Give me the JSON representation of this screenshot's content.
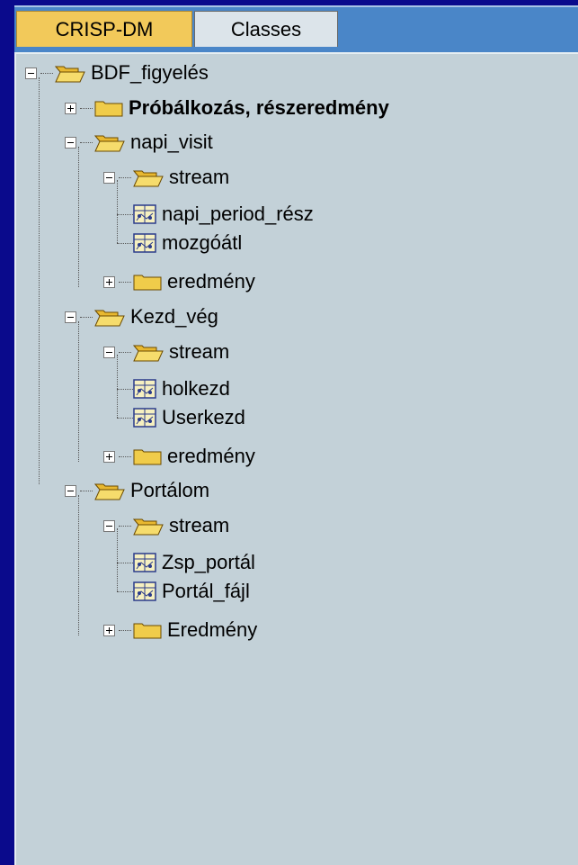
{
  "tabs": [
    {
      "label": "CRISP-DM",
      "active": true
    },
    {
      "label": "Classes",
      "active": false
    }
  ],
  "tree": {
    "root": "BDF_figyelés",
    "items": [
      {
        "label": "Próbálkozás, részeredmény",
        "type": "folder",
        "expanded": false
      },
      {
        "label": "napi_visit",
        "type": "folder",
        "expanded": true
      },
      {
        "label": "stream",
        "type": "folder",
        "expanded": true
      },
      {
        "label": "napi_period_rész",
        "type": "stream"
      },
      {
        "label": "mozgóátl",
        "type": "stream"
      },
      {
        "label": "eredmény",
        "type": "folder",
        "expanded": false
      },
      {
        "label": "Kezd_vég",
        "type": "folder",
        "expanded": true
      },
      {
        "label": "stream",
        "type": "folder",
        "expanded": true
      },
      {
        "label": "holkezd",
        "type": "stream"
      },
      {
        "label": "Userkezd",
        "type": "stream"
      },
      {
        "label": "eredmény",
        "type": "folder",
        "expanded": false
      },
      {
        "label": "Portálom",
        "type": "folder",
        "expanded": true
      },
      {
        "label": "stream",
        "type": "folder",
        "expanded": true
      },
      {
        "label": "Zsp_portál",
        "type": "stream"
      },
      {
        "label": "Portál_fájl",
        "type": "stream"
      },
      {
        "label": "Eredmény",
        "type": "folder",
        "expanded": false
      }
    ]
  },
  "colors": {
    "background": "#0a0a8c",
    "tabbar": "#4a86c8",
    "active_tab": "#f2c95a",
    "panel": "#c3d1d8",
    "folder": "#f0cc4a"
  },
  "icons": {
    "folder_closed": "folder-icon",
    "folder_open": "folder-open-icon",
    "stream": "stream-icon",
    "expand": "plus-box-icon",
    "collapse": "minus-box-icon"
  }
}
